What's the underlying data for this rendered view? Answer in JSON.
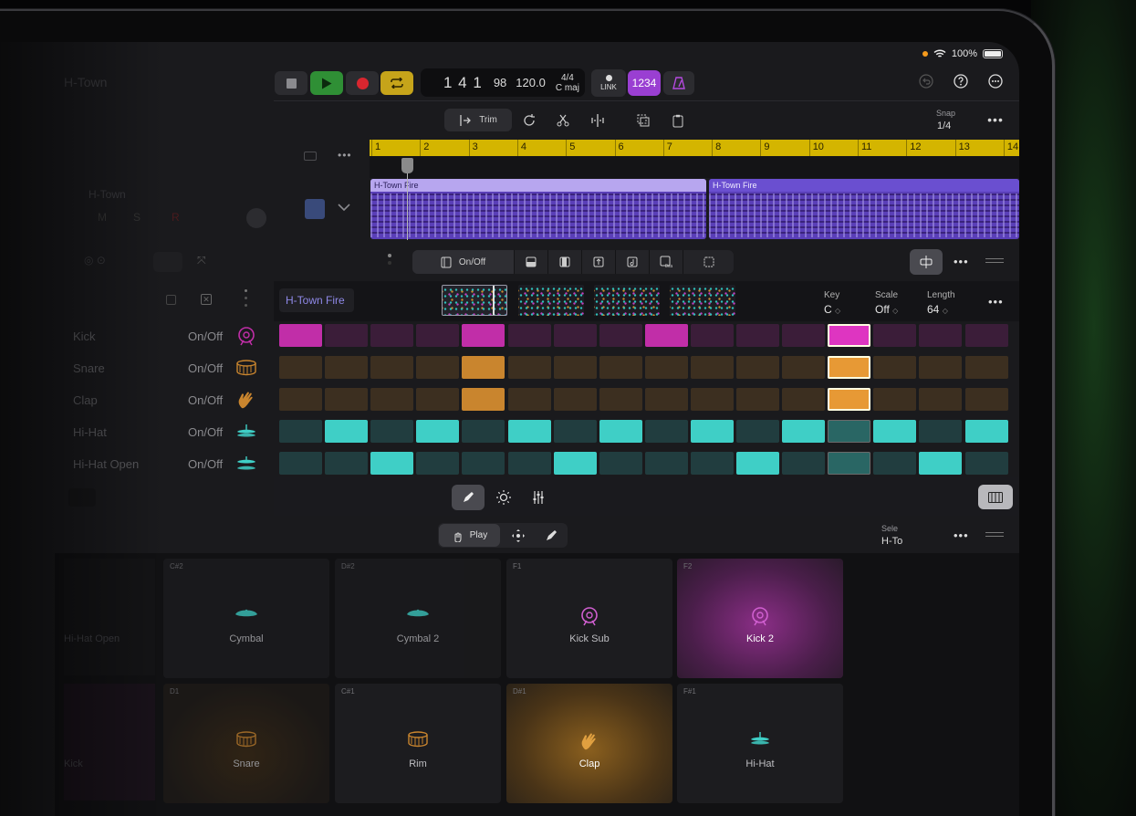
{
  "status": {
    "battery": "100%"
  },
  "header": {
    "project": "H-Town"
  },
  "transport": {
    "position": "1 4 1",
    "ticks": "98",
    "tempo": "120.0",
    "time_sig": "4/4",
    "key": "C maj",
    "link_label": "LINK",
    "count_in": "1234"
  },
  "edit_toolbar": {
    "trim_label": "Trim",
    "snap_label": "Snap",
    "snap_value": "1/4"
  },
  "ruler": {
    "bars": [
      "1",
      "2",
      "3",
      "4",
      "5",
      "6",
      "7",
      "8",
      "9",
      "10",
      "11",
      "12",
      "13",
      "14"
    ]
  },
  "track": {
    "name": "H-Town",
    "m": "M",
    "s": "S",
    "r": "R"
  },
  "regions": [
    {
      "name": "H-Town Fire"
    },
    {
      "name": "H-Town Fire"
    }
  ],
  "step_toolbar": {
    "onoff_label": "On/Off"
  },
  "sequencer": {
    "pattern_name": "H-Town Fire",
    "key_label": "Key",
    "key_value": "C",
    "scale_label": "Scale",
    "scale_value": "Off",
    "length_label": "Length",
    "length_value": "64",
    "rows": [
      {
        "label": "Kick",
        "onoff": "On/Off",
        "icon": "kick-drum-icon",
        "color": "#c12ea8"
      },
      {
        "label": "Snare",
        "onoff": "On/Off",
        "icon": "snare-drum-icon",
        "color": "#c9852e"
      },
      {
        "label": "Clap",
        "onoff": "On/Off",
        "icon": "clap-hand-icon",
        "color": "#c9852e"
      },
      {
        "label": "Hi-Hat",
        "onoff": "On/Off",
        "icon": "hi-hat-icon",
        "color": "#3fcfc6"
      },
      {
        "label": "Hi-Hat Open",
        "onoff": "On/Off",
        "icon": "hi-hat-open-icon",
        "color": "#3fcfc6"
      }
    ]
  },
  "play_toolbar": {
    "play_label": "Play",
    "select_label": "Sele",
    "select_value": "H-To"
  },
  "pads": [
    {
      "note": "C#2",
      "name": "Cymbal",
      "icon": "cymbal-icon"
    },
    {
      "note": "D#2",
      "name": "Cymbal 2",
      "icon": "cymbal-icon"
    },
    {
      "note": "F1",
      "name": "Kick Sub",
      "icon": "kick-drum-icon"
    },
    {
      "note": "F2",
      "name": "Kick 2",
      "icon": "kick-drum-icon"
    },
    {
      "note": "D1",
      "name": "Snare",
      "icon": "snare-drum-icon"
    },
    {
      "note": "C#1",
      "name": "Rim",
      "icon": "snare-drum-icon"
    },
    {
      "note": "D#1",
      "name": "Clap",
      "icon": "clap-hand-icon"
    },
    {
      "note": "F#1",
      "name": "Hi-Hat",
      "icon": "hi-hat-icon"
    }
  ],
  "pads_left": {
    "hh_open": "Hi-Hat Open",
    "kick": "Kick"
  }
}
